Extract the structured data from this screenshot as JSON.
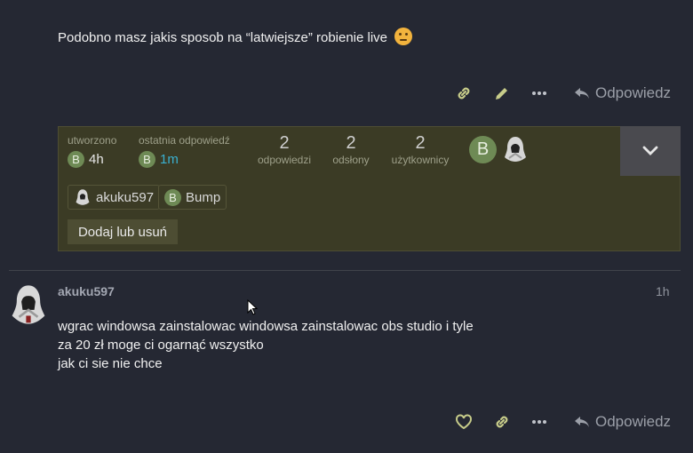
{
  "post1": {
    "text": "Podobno masz jakis sposob na “latwiejsze” robienie live",
    "emoji": "thinking-face-icon",
    "reply_label": "Odpowiedz"
  },
  "topic_map": {
    "created_label": "utworzono",
    "created_time": "4h",
    "last_reply_label": "ostatnia odpowiedź",
    "last_reply_time": "1m",
    "replies_count": "2",
    "replies_label": "odpowiedzi",
    "views_count": "2",
    "views_label": "odsłony",
    "users_count": "2",
    "users_label": "użytkownicy",
    "avatar_letter": "B",
    "chips": [
      {
        "name": "akuku597"
      },
      {
        "name": "Bump",
        "letter": "B"
      }
    ],
    "add_remove_label": "Dodaj lub usuń"
  },
  "post2": {
    "username": "akuku597",
    "time": "1h",
    "lines": [
      "wgrac windowsa zainstalowac windowsa zainstalowac obs studio i tyle",
      "za 20 zł moge ci ogarnąć wszystko",
      "jak ci sie nie chce"
    ],
    "reply_label": "Odpowiedz"
  },
  "colors": {
    "background": "#252833",
    "accent_icon": "#c7cc8a",
    "topic_map_bg": "#3b3b25",
    "avatar_green": "#6e8a55",
    "link_blue": "#3ab0d0"
  }
}
